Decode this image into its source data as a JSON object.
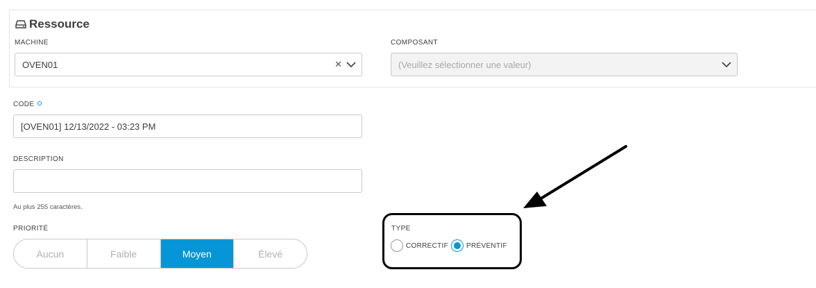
{
  "resource": {
    "title": "Ressource",
    "machine_label": "MACHINE",
    "machine_value": "OVEN01",
    "component_label": "COMPOSANT",
    "component_placeholder": "(Veuillez sélectionner une valeur)"
  },
  "code": {
    "label": "CODE",
    "value": "[OVEN01] 12/13/2022 - 03:23 PM"
  },
  "description": {
    "label": "DESCRIPTION",
    "value": "",
    "hint": "Au plus 255 caractères."
  },
  "priority": {
    "label": "PRIORITÉ",
    "options": [
      "Aucun",
      "Faible",
      "Moyen",
      "Élevé"
    ],
    "selected": "Moyen"
  },
  "type": {
    "label": "TYPE",
    "options": [
      "CORRECTIF",
      "PRÉVENTIF"
    ],
    "selected": "PRÉVENTIF"
  },
  "icons": {
    "resource": "drive-icon",
    "clear": "clear-x-icon",
    "dropdown": "chevron-down-icon",
    "required": "required-dot-icon"
  },
  "colors": {
    "accent": "#0696d7",
    "annotation": "#000000",
    "border": "#c8c8c8",
    "disabled_bg": "#f3f3f3"
  }
}
